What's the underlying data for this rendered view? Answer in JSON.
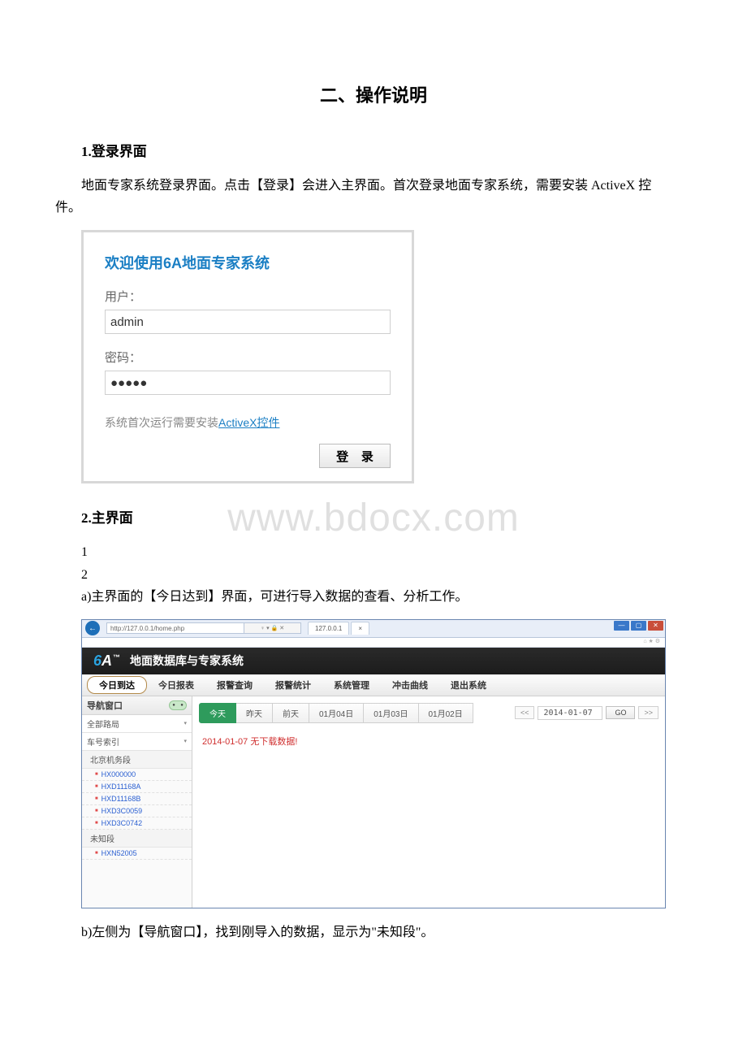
{
  "watermark": "www.bdocx.com",
  "doc": {
    "title": "二、操作说明",
    "s1": {
      "heading": "1.登录界面",
      "p1": "地面专家系统登录界面。点击【登录】会进入主界面。首次登录地面专家系统，需要安装 ActiveX 控件。"
    },
    "s2": {
      "heading": "2.主界面",
      "n1": "1",
      "n2": "2",
      "p_a": "a)主界面的【今日达到】界面，可进行导入数据的查看、分析工作。",
      "p_b": "b)左侧为【导航窗口】，找到刚导入的数据，显示为\"未知段\"。"
    }
  },
  "login": {
    "welcome": "欢迎使用6A地面专家系统",
    "user_label": "用户：",
    "user_value": "admin",
    "pass_label": "密码：",
    "pass_value": "●●●●●",
    "hint_prefix": "系统首次运行需要安装",
    "hint_link": "ActiveX控件",
    "button": "登 录"
  },
  "app": {
    "title": "地面数据库与专家系统",
    "addr": "http://127.0.0.1/home.php",
    "addr_suffix": "♀ ▾ 🔒 ✕ ",
    "tab1": "127.0.0.1",
    "tab2": "× ",
    "nav": {
      "today": "今日到达",
      "report": "今日报表",
      "alarm_q": "报警查询",
      "alarm_s": "报警统计",
      "sysmgr": "系统管理",
      "curve": "冲击曲线",
      "exit": "退出系统"
    },
    "sidebar": {
      "title": "导航窗口",
      "row_bureau": "全部路局",
      "row_index": "车号索引",
      "group_beijing": "北京机务段",
      "items": [
        "HX000000",
        "HXD11168A",
        "HXD11168B",
        "HXD3C0059",
        "HXD3C0742"
      ],
      "group_unknown": "未知段",
      "items_unk": [
        "HXN52005"
      ]
    },
    "content": {
      "tabs": [
        "今天",
        "昨天",
        "前天",
        "01月04日",
        "01月03日",
        "01月02日"
      ],
      "prev": "<<",
      "date": "2014-01-07",
      "go": "GO",
      "next": ">>",
      "no_data": "2014-01-07 无下载数据!"
    }
  }
}
